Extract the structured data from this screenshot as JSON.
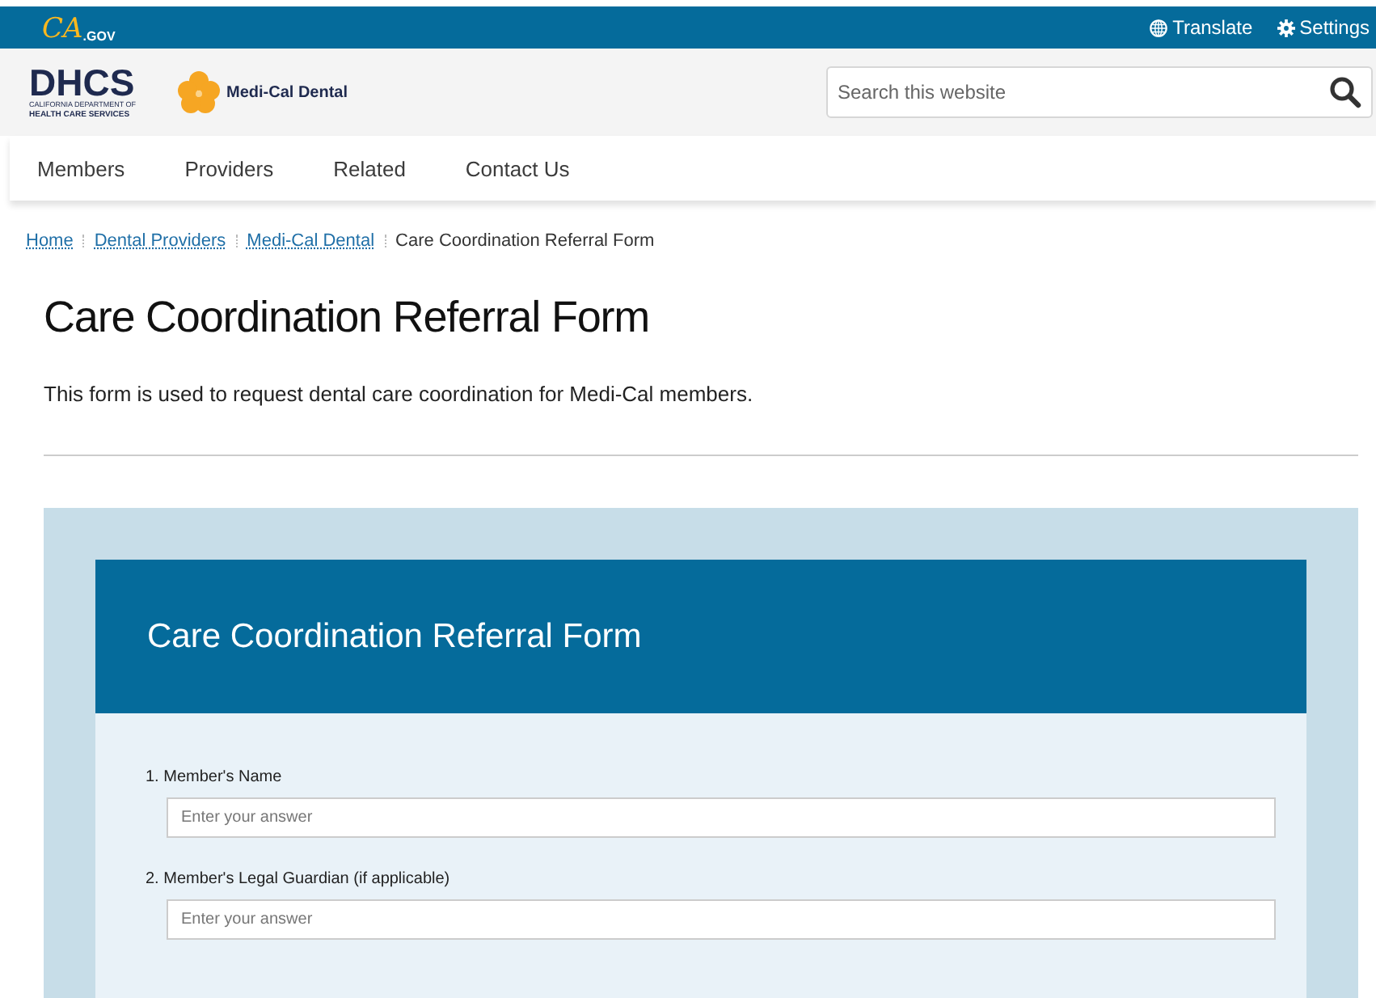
{
  "top_bar": {
    "logo": {
      "letters": "CA",
      "suffix": ".GOV"
    },
    "links": [
      {
        "kind": "globe",
        "label": "Translate"
      },
      {
        "kind": "gear",
        "label": "Settings"
      }
    ]
  },
  "header": {
    "agency_logo": {
      "letters": "DHCS",
      "line_1": "CALIFORNIA DEPARTMENT OF",
      "line_2": "HEALTH CARE SERVICES"
    },
    "program_name": "Medi-Cal Dental",
    "search": {
      "placeholder": "Search this website"
    }
  },
  "nav": [
    "Members",
    "Providers",
    "Related",
    "Contact Us"
  ],
  "breadcrumb": [
    {
      "label": "Home",
      "link": true
    },
    {
      "label": "Dental Providers",
      "link": true
    },
    {
      "label": "Medi-Cal Dental",
      "link": true
    },
    {
      "label": "Care Coordination Referral Form",
      "link": false
    }
  ],
  "page_title": "Care Coordination Referral Form",
  "intro": "This form is used to request dental care coordination for Medi-Cal members.",
  "form": {
    "title": "Care Coordination Referral Form",
    "questions": [
      {
        "label": "1. Member's Name",
        "placeholder": "Enter your answer"
      },
      {
        "label": "2. Member's Legal Guardian (if applicable)",
        "placeholder": "Enter your answer"
      }
    ]
  }
}
